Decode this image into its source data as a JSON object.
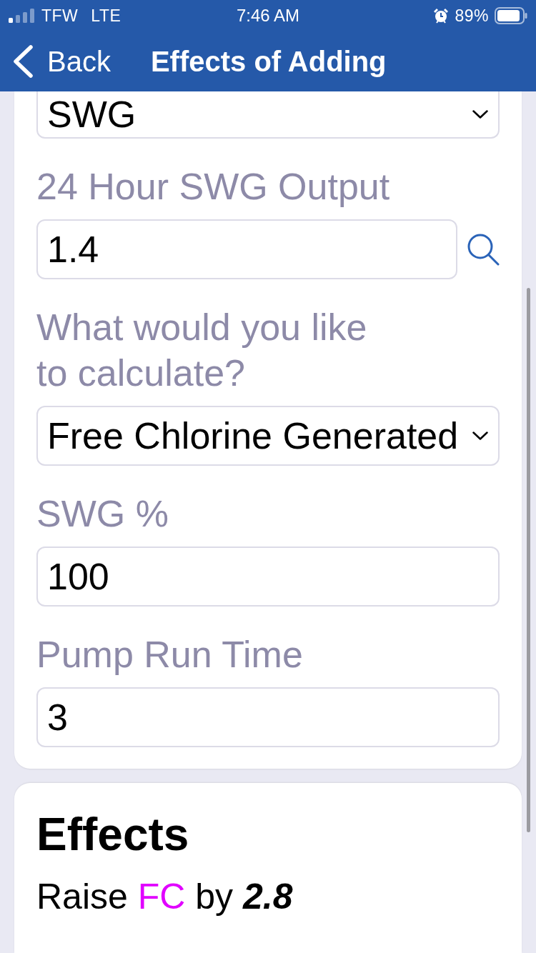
{
  "status_bar": {
    "carrier": "TFW",
    "network": "LTE",
    "time": "7:46 AM",
    "battery": "89%"
  },
  "nav": {
    "back": "Back",
    "title": "Effects of Adding"
  },
  "form": {
    "fields": [
      {
        "kind": "select",
        "value": "SWG",
        "lookup": false
      },
      {
        "kind": "input",
        "label": "24 Hour SWG Output",
        "value": "1.4",
        "lookup": true
      },
      {
        "kind": "select",
        "label": "What would you like to calculate?",
        "value": "Free Chlorine Generated",
        "lookup": false
      },
      {
        "kind": "input",
        "label": "SWG %",
        "value": "100",
        "lookup": false
      },
      {
        "kind": "input",
        "label": "Pump Run Time",
        "value": "3",
        "lookup": false
      }
    ]
  },
  "effects": {
    "title": "Effects",
    "result": [
      {
        "kind": "plain",
        "text": "Raise"
      },
      {
        "kind": "chemical",
        "text": "FC"
      },
      {
        "kind": "plain",
        "text": "by"
      },
      {
        "kind": "amount",
        "text": "2.8"
      }
    ]
  }
}
